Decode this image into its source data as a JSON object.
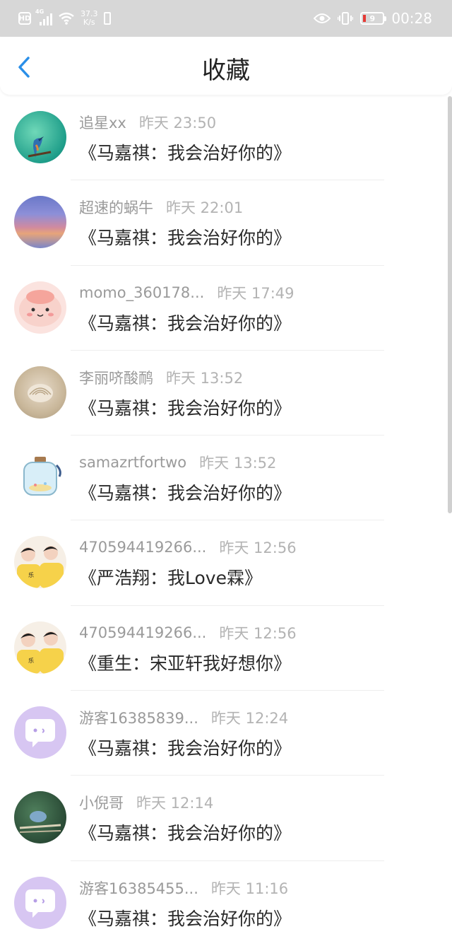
{
  "status_bar": {
    "hd": "HD",
    "network": "4G",
    "speed_value": "37.3",
    "speed_unit": "K/s",
    "battery": "9",
    "time": "00:28"
  },
  "header": {
    "title": "收藏"
  },
  "colors": {
    "accent": "#2a8fe8",
    "status_bg": "#d7d7d7",
    "battery_low": "#e53935"
  },
  "items": [
    {
      "user": "追星xx",
      "time": "昨天 23:50",
      "book": "《马嘉祺：我会治好你的》"
    },
    {
      "user": "超速的蜗牛",
      "time": "昨天 22:01",
      "book": "《马嘉祺：我会治好你的》"
    },
    {
      "user": "momo_360178...",
      "time": "昨天 17:49",
      "book": "《马嘉祺：我会治好你的》"
    },
    {
      "user": "李丽哜酸鸸",
      "time": "昨天 13:52",
      "book": "《马嘉祺：我会治好你的》"
    },
    {
      "user": "samazrtfortwo",
      "time": "昨天 13:52",
      "book": "《马嘉祺：我会治好你的》"
    },
    {
      "user": "470594419266...",
      "time": "昨天 12:56",
      "book": "《严浩翔：我Love霖》"
    },
    {
      "user": "470594419266...",
      "time": "昨天 12:56",
      "book": "《重生：宋亚轩我好想你》"
    },
    {
      "user": "游客16385839...",
      "time": "昨天 12:24",
      "book": "《马嘉祺：我会治好你的》"
    },
    {
      "user": "小倪哥",
      "time": "昨天 12:14",
      "book": "《马嘉祺：我会治好你的》"
    },
    {
      "user": "游客16385455...",
      "time": "昨天 11:16",
      "book": "《马嘉祺：我会治好你的》"
    }
  ]
}
